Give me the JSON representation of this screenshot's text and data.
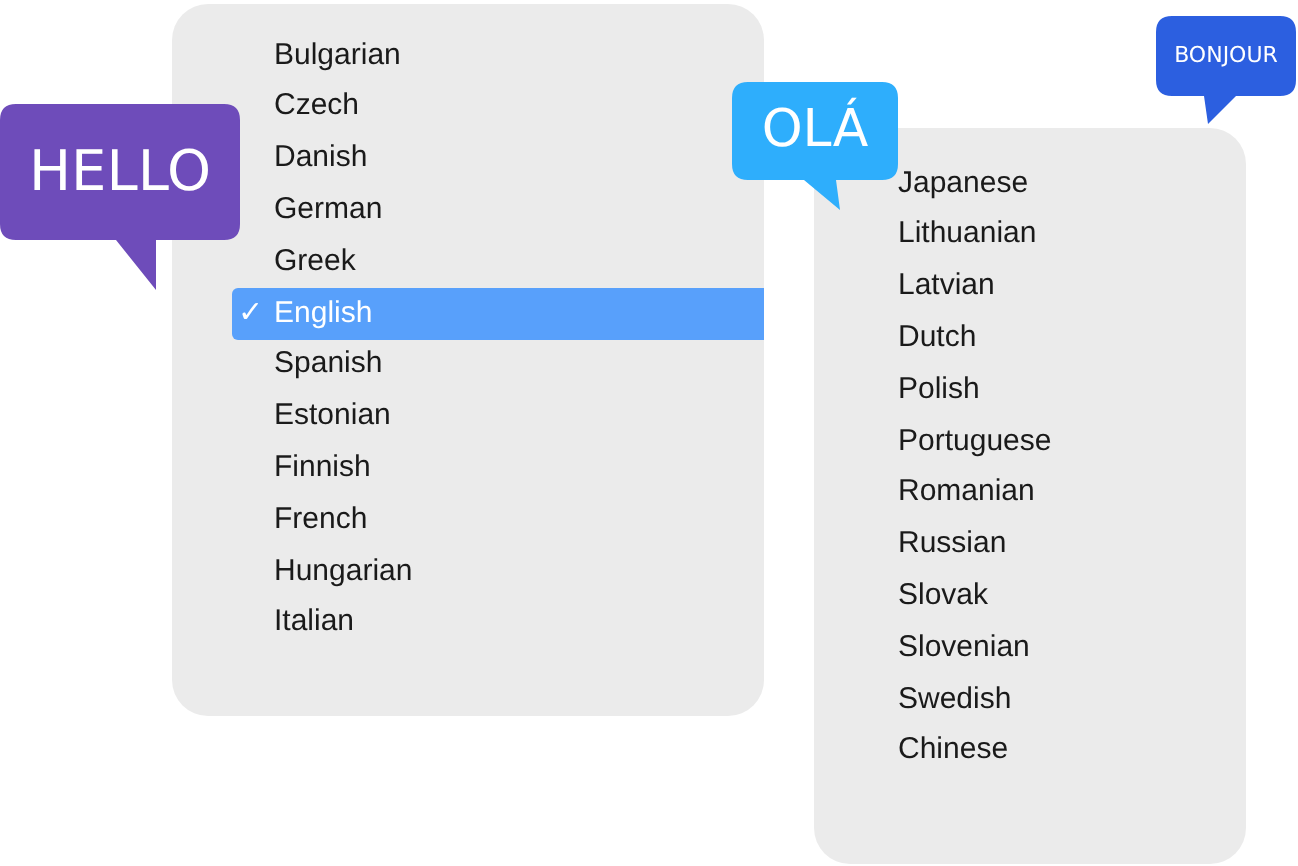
{
  "menus": [
    {
      "items": [
        {
          "label": "Bulgarian",
          "selected": false
        },
        {
          "label": "Czech",
          "selected": false
        },
        {
          "label": "Danish",
          "selected": false
        },
        {
          "label": "German",
          "selected": false
        },
        {
          "label": "Greek",
          "selected": false
        },
        {
          "label": "English",
          "selected": true
        },
        {
          "label": "Spanish",
          "selected": false
        },
        {
          "label": "Estonian",
          "selected": false
        },
        {
          "label": "Finnish",
          "selected": false
        },
        {
          "label": "French",
          "selected": false
        },
        {
          "label": "Hungarian",
          "selected": false
        },
        {
          "label": "Italian",
          "selected": false
        }
      ]
    },
    {
      "items": [
        {
          "label": "Japanese",
          "selected": false
        },
        {
          "label": "Lithuanian",
          "selected": false
        },
        {
          "label": "Latvian",
          "selected": false
        },
        {
          "label": "Dutch",
          "selected": false
        },
        {
          "label": "Polish",
          "selected": false
        },
        {
          "label": "Portuguese",
          "selected": false
        },
        {
          "label": "Romanian",
          "selected": false
        },
        {
          "label": "Russian",
          "selected": false
        },
        {
          "label": "Slovak",
          "selected": false
        },
        {
          "label": "Slovenian",
          "selected": false
        },
        {
          "label": "Swedish",
          "selected": false
        },
        {
          "label": "Chinese",
          "selected": false
        }
      ]
    }
  ],
  "bubbles": [
    {
      "text": "HELLO",
      "color": "#6e4cba"
    },
    {
      "text": "OLÁ",
      "color": "#2eaefc"
    },
    {
      "text": "BONJOUR",
      "color": "#2c5fe0"
    }
  ],
  "check": "✓"
}
